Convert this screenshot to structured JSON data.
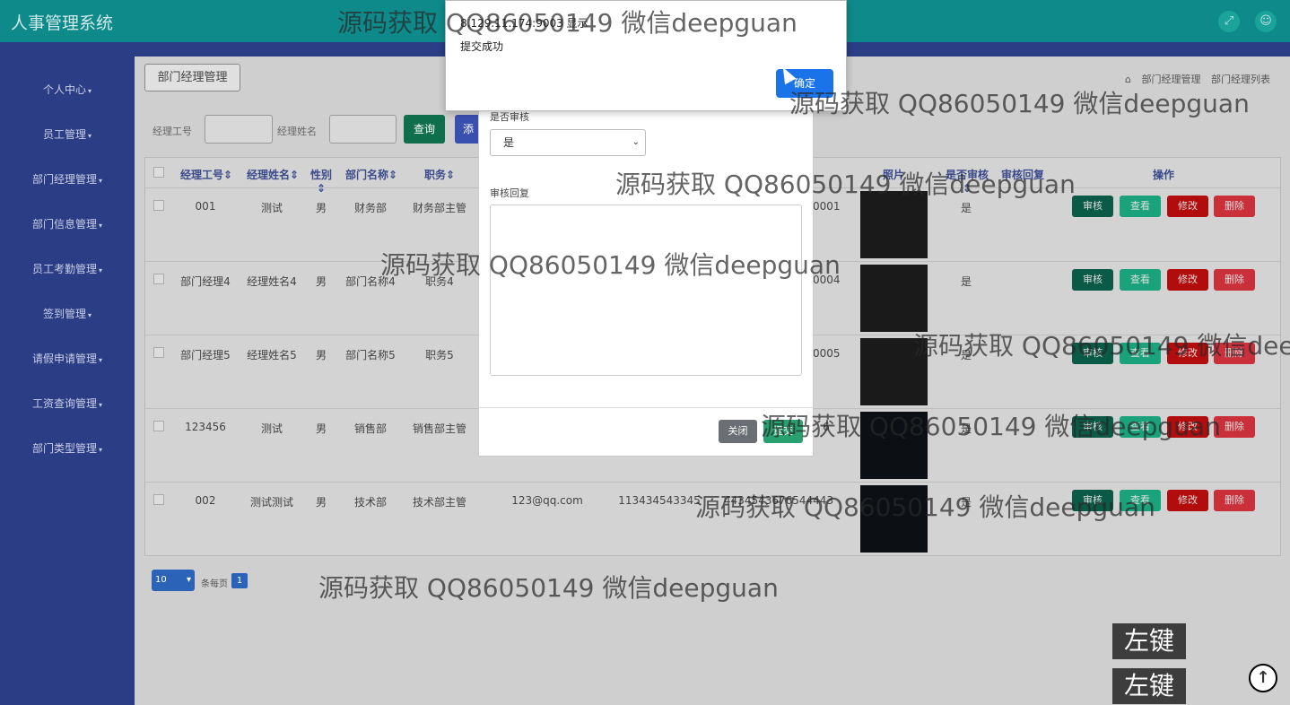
{
  "header": {
    "app_title": "人事管理系统",
    "fullscreen_icon": "expand-icon",
    "user_icon": "user-icon"
  },
  "sidebar": {
    "items": [
      {
        "label": "个人中心"
      },
      {
        "label": "员工管理"
      },
      {
        "label": "部门经理管理"
      },
      {
        "label": "部门信息管理"
      },
      {
        "label": "员工考勤管理"
      },
      {
        "label": "签到管理"
      },
      {
        "label": "请假申请管理"
      },
      {
        "label": "工资查询管理"
      },
      {
        "label": "部门类型管理"
      }
    ]
  },
  "page": {
    "tab_title": "部门经理管理",
    "breadcrumb": [
      "部门经理管理",
      "部门经理列表"
    ],
    "search": {
      "manager_no_label": "经理工号",
      "manager_name_label": "经理姓名",
      "query_btn": "查询",
      "add_btn": "添"
    }
  },
  "table": {
    "headers": [
      "经理工号",
      "经理姓名",
      "性别",
      "部门名称",
      "职务",
      "照片",
      "是否审核",
      "审核回复",
      "操作"
    ],
    "rows": [
      {
        "no": "001",
        "name": "测试",
        "gender": "男",
        "dept": "财务部",
        "title": "财务部主管",
        "email": "",
        "phone": "",
        "idno": "0001",
        "audit": "是"
      },
      {
        "no": "部门经理4",
        "name": "经理姓名4",
        "gender": "男",
        "dept": "部门名称4",
        "title": "职务4",
        "email": "",
        "phone": "",
        "idno": "0004",
        "audit": "是"
      },
      {
        "no": "部门经理5",
        "name": "经理姓名5",
        "gender": "男",
        "dept": "部门名称5",
        "title": "职务5",
        "email": "",
        "phone": "",
        "idno": "0005",
        "audit": "是"
      },
      {
        "no": "123456",
        "name": "测试",
        "gender": "男",
        "dept": "销售部",
        "title": "销售部主管",
        "email": "",
        "phone": "",
        "idno": "6",
        "audit": "是"
      },
      {
        "no": "002",
        "name": "测试测试",
        "gender": "男",
        "dept": "技术部",
        "title": "技术部主管",
        "email": "123@qq.com",
        "phone": "113434543345",
        "idno": "4434543676544443",
        "audit": "是"
      }
    ],
    "actions": {
      "audit": "审核",
      "view": "查看",
      "edit": "修改",
      "delete": "删除"
    }
  },
  "pager": {
    "page_size": "10",
    "per_page_label": "条每页",
    "current_page": "1"
  },
  "modal": {
    "audit_label": "是否审核",
    "audit_value": "是",
    "reply_label": "审核回复",
    "close_btn": "关闭",
    "submit_btn": "提交"
  },
  "alert": {
    "origin": "8.129.11.174:9003 显示",
    "message": "提交成功",
    "ok_btn": "确定"
  },
  "overlay": {
    "key_tag_1": "左键",
    "key_tag_2": "左键",
    "upload_icon": "arrow-up-icon"
  },
  "watermark": {
    "text": "源码获取 QQ86050149 微信deepguan"
  },
  "colors": {
    "header": "#0e8a8a",
    "sidebar": "#2a3d85",
    "audit_btn": "#0a5a45",
    "view_btn": "#1aa37a",
    "edit_btn": "#b30c0c",
    "delete_btn": "#c9303a",
    "alert_ok": "#1a73e8"
  }
}
